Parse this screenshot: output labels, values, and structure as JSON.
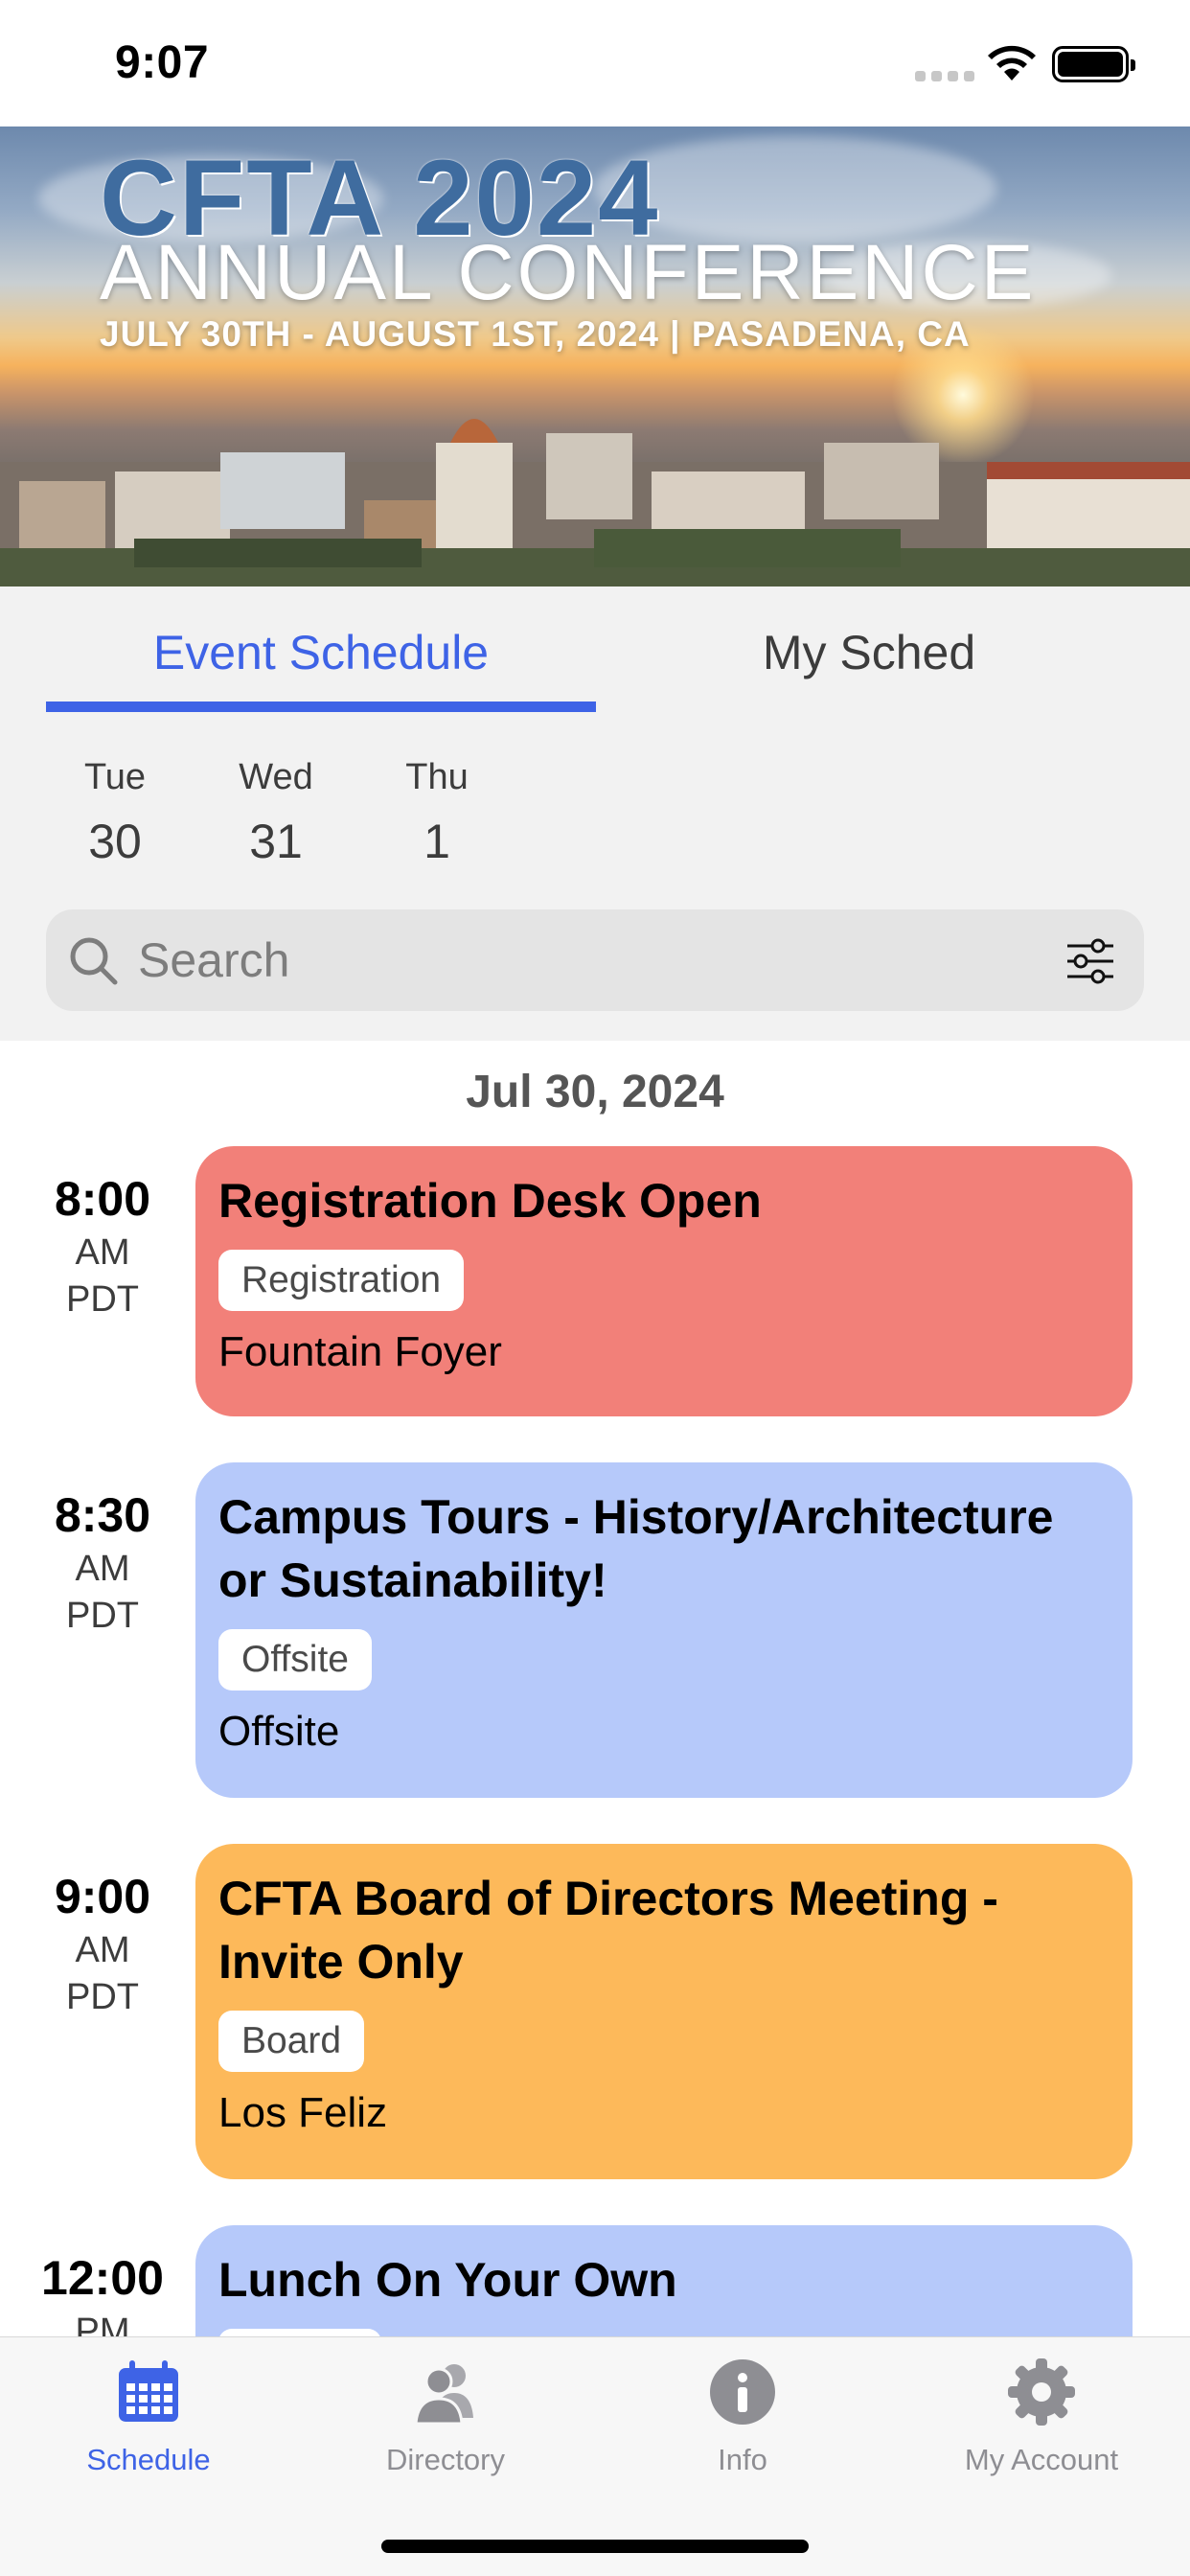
{
  "status_bar": {
    "time": "9:07"
  },
  "banner": {
    "title_line1": "CFTA 2024",
    "title_line2": "ANNUAL CONFERENCE",
    "subtitle": "JULY 30TH - AUGUST 1ST, 2024 | PASADENA, CA"
  },
  "tabs": {
    "event_schedule": "Event Schedule",
    "my_sched": "My Sched",
    "active": "event_schedule"
  },
  "days": [
    {
      "dow": "Tue",
      "num": "30"
    },
    {
      "dow": "Wed",
      "num": "31"
    },
    {
      "dow": "Thu",
      "num": "1"
    }
  ],
  "search": {
    "placeholder": "Search"
  },
  "schedule": {
    "date_header": "Jul 30, 2024",
    "events": [
      {
        "time": "8:00",
        "ampm": "AM",
        "tz": "PDT",
        "title": "Registration Desk Open",
        "tag": "Registration",
        "location": "Fountain Foyer",
        "color": "#f28079"
      },
      {
        "time": "8:30",
        "ampm": "AM",
        "tz": "PDT",
        "title": "Campus Tours - History/Architecture or Sustainability!",
        "tag": "Offsite",
        "location": "Offsite",
        "color": "#b6c9fa"
      },
      {
        "time": "9:00",
        "ampm": "AM",
        "tz": "PDT",
        "title": "CFTA Board of Directors Meeting - Invite Only",
        "tag": "Board",
        "location": "Los Feliz",
        "color": "#fdb95a"
      },
      {
        "time": "12:00",
        "ampm": "PM",
        "tz": "",
        "title": "Lunch On Your Own",
        "tag": "",
        "location": "",
        "color": "#b6c9fa"
      }
    ]
  },
  "tabbar": {
    "items": [
      {
        "label": "Schedule",
        "icon": "calendar-icon",
        "active": true
      },
      {
        "label": "Directory",
        "icon": "people-icon",
        "active": false
      },
      {
        "label": "Info",
        "icon": "info-icon",
        "active": false
      },
      {
        "label": "My Account",
        "icon": "gear-icon",
        "active": false
      }
    ]
  },
  "colors": {
    "accent": "#3e63e6",
    "inactive": "#8e8e93"
  }
}
